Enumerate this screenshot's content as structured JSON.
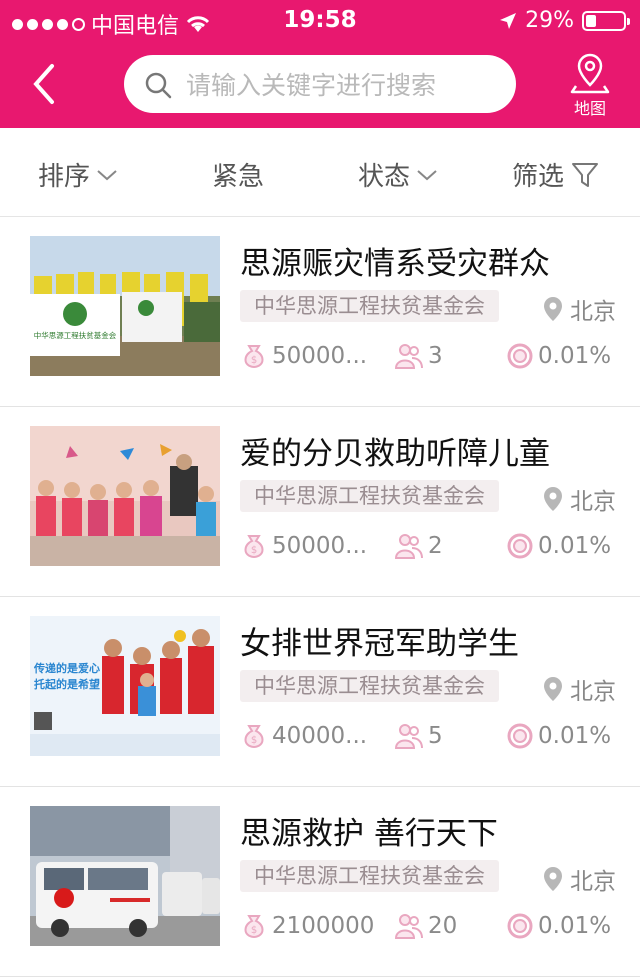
{
  "status_bar": {
    "carrier": "中国电信",
    "time": "19:58",
    "battery": "29%",
    "battery_level": 0.29
  },
  "header": {
    "search_placeholder": "请输入关键字进行搜索",
    "map_label": "地图"
  },
  "filters": {
    "sort": "排序",
    "urgent": "紧急",
    "status": "状态",
    "filter": "筛选"
  },
  "items": [
    {
      "title": "思源赈灾情系受灾群众",
      "org": "中华思源工程扶贫基金会",
      "location": "北京",
      "amount": "50000...",
      "people": "3",
      "progress": "0.01%"
    },
    {
      "title": "爱的分贝救助听障儿童",
      "org": "中华思源工程扶贫基金会",
      "location": "北京",
      "amount": "50000...",
      "people": "2",
      "progress": "0.01%"
    },
    {
      "title": "女排世界冠军助学生",
      "org": "中华思源工程扶贫基金会",
      "location": "北京",
      "amount": "40000...",
      "people": "5",
      "progress": "0.01%"
    },
    {
      "title": "思源救护 善行天下",
      "org": "中华思源工程扶贫基金会",
      "location": "北京",
      "amount": "2100000",
      "people": "20",
      "progress": "0.01%"
    }
  ],
  "colors": {
    "brand": "#e8186f",
    "icon_pink": "#e9a7c0"
  },
  "images": [
    {
      "logo_text": "中华思源工程扶贫基金会"
    },
    {},
    {
      "banner_text_1": "传递的是爱心",
      "banner_text_2": "托起的是希望"
    },
    {}
  ]
}
